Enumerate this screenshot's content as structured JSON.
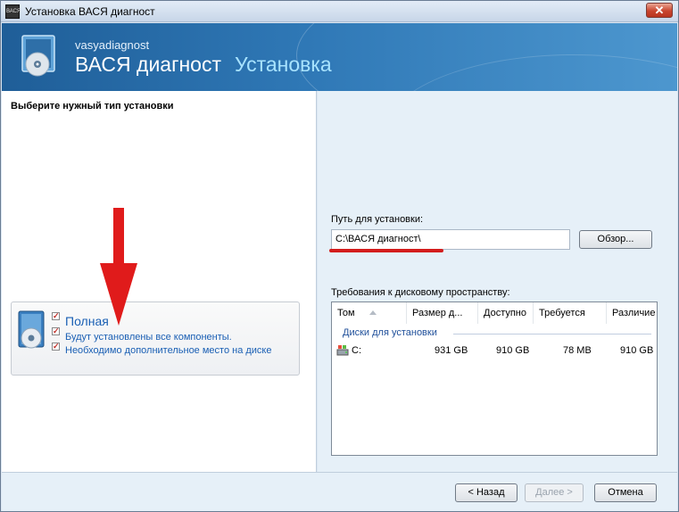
{
  "window": {
    "title": "Установка ВАСЯ диагност",
    "app_icon_text": "ВАСЯ",
    "close_symbol": "✕"
  },
  "banner": {
    "company": "vasyadiagnost",
    "product": "ВАСЯ диагност",
    "subtitle": "Установка"
  },
  "left": {
    "heading": "Выберите нужный тип установки",
    "option": {
      "title": "Полная",
      "desc_line1": "Будут установлены все компоненты.",
      "desc_line2": "Необходимо дополнительное место на диске",
      "checks": [
        "✓",
        "✓",
        "✓"
      ]
    }
  },
  "right": {
    "path_label": "Путь для установки:",
    "path_value": "C:\\ВАСЯ диагност\\",
    "browse_label": "Обзор...",
    "requirements_label": "Требования к дисковому пространству:",
    "table": {
      "columns": [
        "Том",
        "Размер д...",
        "Доступно",
        "Требуется",
        "Различие"
      ],
      "group": "Диски для установки",
      "rows": [
        {
          "volume": "C:",
          "size": "931 GB",
          "available": "910 GB",
          "required": "78 MB",
          "difference": "910 GB"
        }
      ]
    }
  },
  "footer": {
    "back_label": "< Назад",
    "next_label": "Далее >",
    "cancel_label": "Отмена"
  },
  "colors": {
    "accent_link": "#1a5fb4",
    "annotation_red": "#d31d1d"
  }
}
